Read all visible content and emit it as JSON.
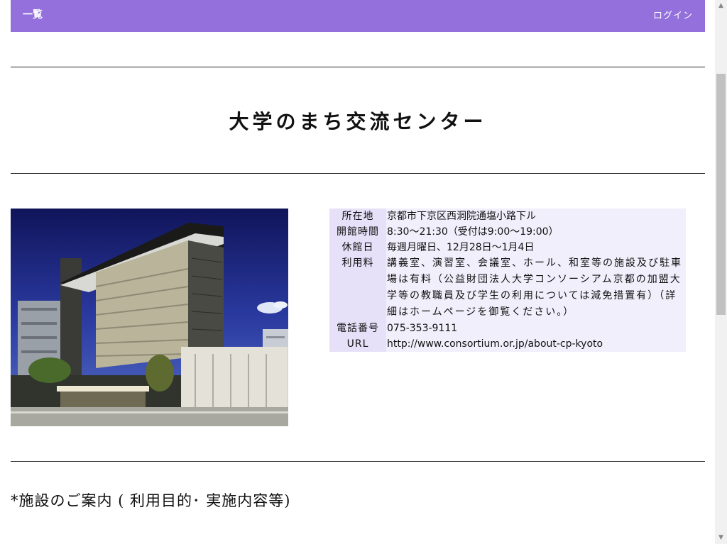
{
  "header": {
    "list_label": "一覧",
    "login_label": "ログイン",
    "bg_color": "#9370db"
  },
  "page_title": "大学のまち交流センター",
  "photo": {
    "icon": "building-photo"
  },
  "info": {
    "rows": [
      {
        "label": "所在地",
        "value": "京都市下京区西洞院通塩小路下ル"
      },
      {
        "label": "開館時間",
        "value": "8:30～21:30（受付は9:00～19:00）"
      },
      {
        "label": "休館日",
        "value": "毎週月曜日、12月28日～1月4日"
      },
      {
        "label": "利用料",
        "value": "講義室、演習室、会議室、ホール、和室等の施設及び駐車場は有料（公益財団法人大学コンソーシアム京都の加盟大学等の教職員及び学生の利用については減免措置有）（詳細はホームページを御覧ください。）"
      },
      {
        "label": "電話番号",
        "value": "075-353-9111"
      },
      {
        "label": "URL",
        "value": "http://www.consortium.or.jp/about-cp-kyoto"
      }
    ]
  },
  "section_heading": "*施設のご案内 ( 利用目的･  実施内容等)"
}
